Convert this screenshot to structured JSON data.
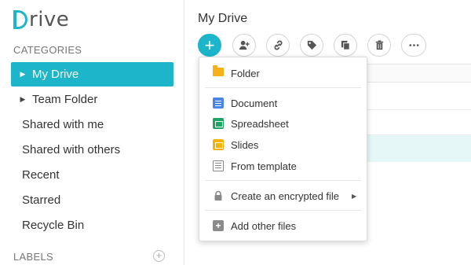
{
  "app": {
    "logo_text": "rive"
  },
  "sidebar": {
    "categories_label": "CATEGORIES",
    "items": [
      {
        "label": "My Drive"
      },
      {
        "label": "Team Folder"
      },
      {
        "label": "Shared with me"
      },
      {
        "label": "Shared with others"
      },
      {
        "label": "Recent"
      },
      {
        "label": "Starred"
      },
      {
        "label": "Recycle Bin"
      }
    ],
    "labels_label": "LABELS"
  },
  "main": {
    "title": "My Drive",
    "toolbar": {
      "new_icon": "plus-icon",
      "buttons": [
        "add-user-icon",
        "link-icon",
        "tag-icon",
        "copy-icon",
        "trash-icon",
        "more-icon"
      ]
    }
  },
  "menu": {
    "items": [
      {
        "label": "Folder",
        "icon": "folder-icon"
      },
      {
        "label": "Document",
        "icon": "document-icon"
      },
      {
        "label": "Spreadsheet",
        "icon": "spreadsheet-icon"
      },
      {
        "label": "Slides",
        "icon": "slides-icon"
      },
      {
        "label": "From template",
        "icon": "template-icon"
      },
      {
        "label": "Create an encrypted file",
        "icon": "lock-icon"
      },
      {
        "label": "Add other files",
        "icon": "add-file-icon"
      }
    ]
  },
  "colors": {
    "accent": "#1cb5c9",
    "folder": "#f6b11a",
    "document": "#4a86e8",
    "spreadsheet": "#1fa463",
    "slides": "#f4b400"
  }
}
